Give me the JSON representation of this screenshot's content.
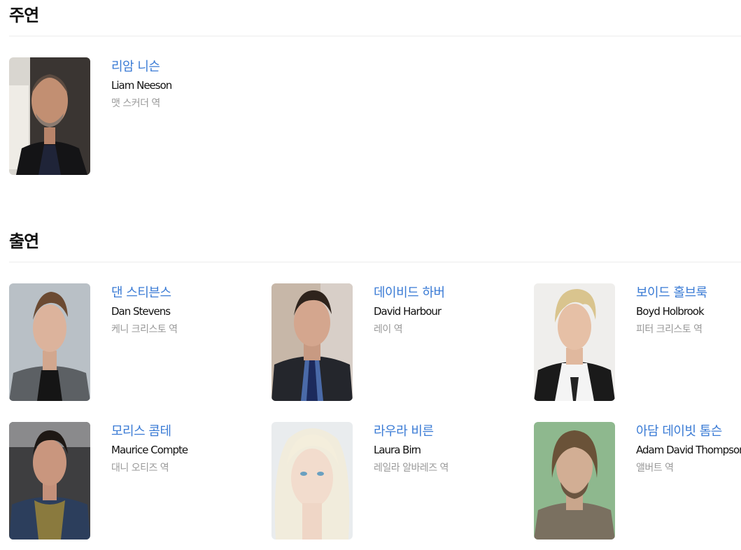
{
  "lead": {
    "heading": "주연",
    "cast": [
      {
        "name_ko": "리암 니슨",
        "name_en": "Liam Neeson",
        "role": "맷 스커더 역",
        "photo": "liam-neeson-photo"
      }
    ]
  },
  "supporting": {
    "heading": "출연",
    "cast": [
      {
        "name_ko": "댄 스티븐스",
        "name_en": "Dan Stevens",
        "role": "케니 크리스토 역",
        "photo": "dan-stevens-photo"
      },
      {
        "name_ko": "데이비드 하버",
        "name_en": "David Harbour",
        "role": "레이 역",
        "photo": "david-harbour-photo"
      },
      {
        "name_ko": "보이드 홀브룩",
        "name_en": "Boyd Holbrook",
        "role": "피터 크리스토 역",
        "photo": "boyd-holbrook-photo"
      },
      {
        "name_ko": "모리스 콤테",
        "name_en": "Maurice Compte",
        "role": "대니 오티즈 역",
        "photo": "maurice-compte-photo"
      },
      {
        "name_ko": "라우라 비른",
        "name_en": "Laura Birn",
        "role": "레일라 알바레즈 역",
        "photo": "laura-birn-photo"
      },
      {
        "name_ko": "아담 데이빗 톰슨",
        "name_en": "Adam David Thompson",
        "role": "앨버트 역",
        "photo": "adam-david-thompson-photo"
      }
    ]
  },
  "colors": {
    "name_link": "#3a7bd5",
    "role_text": "#999999",
    "divider": "#ececec"
  }
}
